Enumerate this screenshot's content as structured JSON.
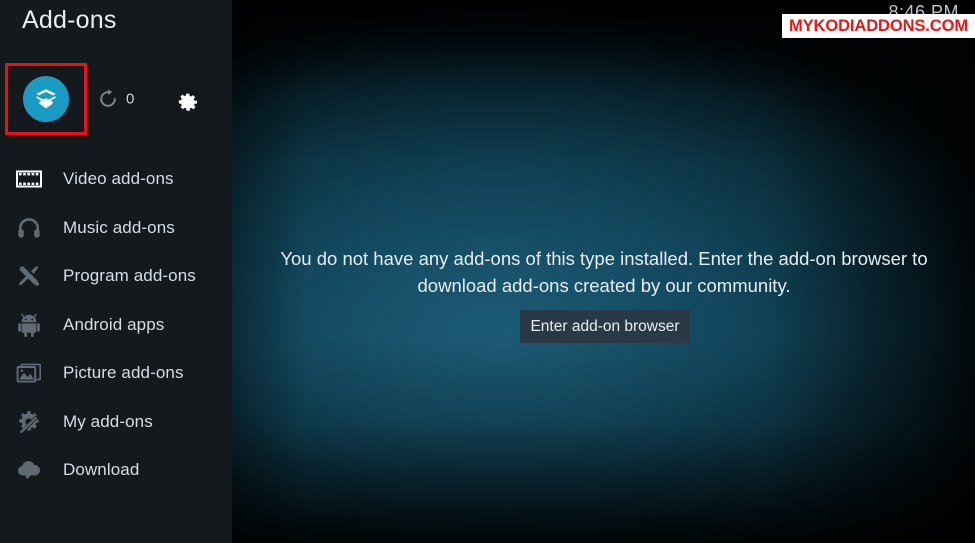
{
  "window": {
    "title": "Add-ons",
    "clock": "8:46 PM"
  },
  "toolbar": {
    "addon_tile": {
      "icon": "package-box-icon",
      "highlight_color": "#ee1111",
      "circle_color": "#1a9bc4"
    },
    "refresh": {
      "icon": "refresh-icon",
      "count": "0"
    },
    "settings": {
      "icon": "gear-icon"
    }
  },
  "sidebar": {
    "items": [
      {
        "label": "Video add-ons",
        "icon": "film-strip-icon",
        "active": true
      },
      {
        "label": "Music add-ons",
        "icon": "headphones-icon",
        "active": false
      },
      {
        "label": "Program add-ons",
        "icon": "tools-icon",
        "active": false
      },
      {
        "label": "Android apps",
        "icon": "android-icon",
        "active": false
      },
      {
        "label": "Picture add-ons",
        "icon": "photos-icon",
        "active": false
      },
      {
        "label": "My add-ons",
        "icon": "gear-wand-icon",
        "active": false
      },
      {
        "label": "Download",
        "icon": "cloud-download-icon",
        "active": false
      }
    ]
  },
  "main": {
    "empty_message": "You do not have any add-ons of this type installed. Enter the add-on browser to download add-ons created by our community.",
    "browser_button_label": "Enter add-on browser"
  },
  "watermark": {
    "text": "MYKODIADDONS.COM",
    "text_color": "#f01414",
    "background_color": "#ffffff"
  }
}
